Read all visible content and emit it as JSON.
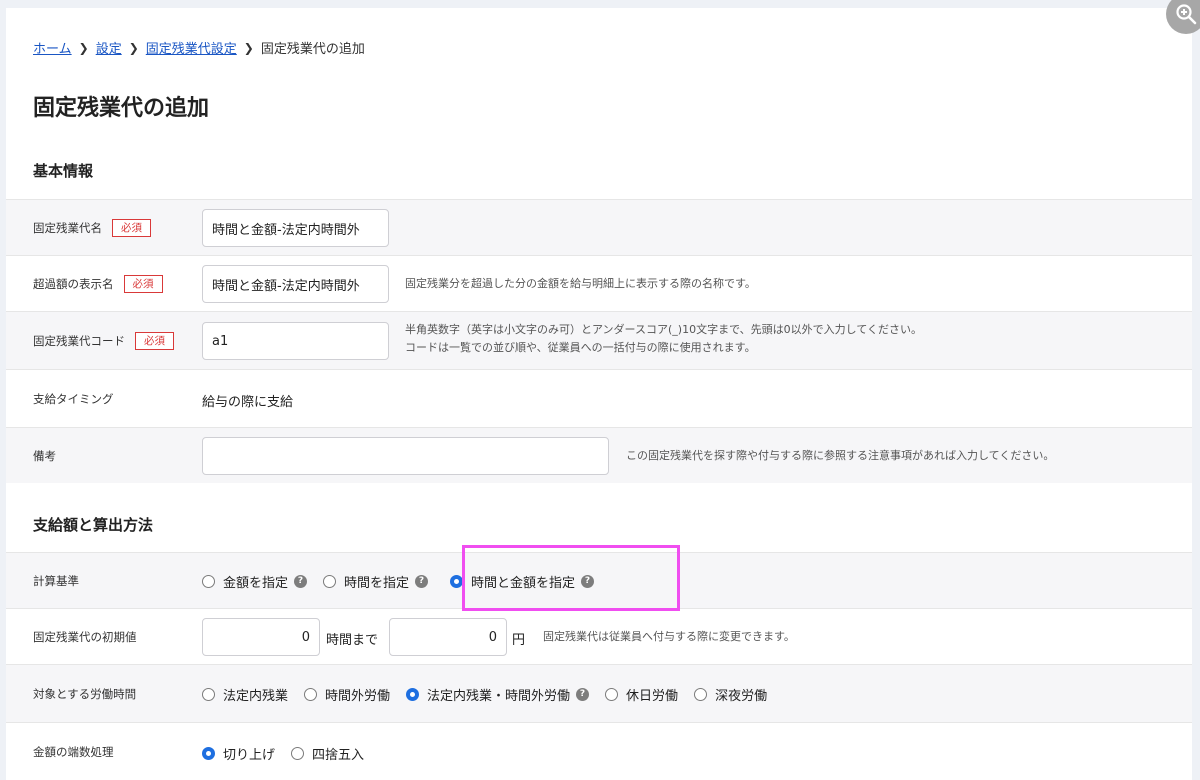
{
  "breadcrumb": {
    "home": "ホーム",
    "settings": "設定",
    "fixed_overtime_settings": "固定残業代設定",
    "current": "固定残業代の追加"
  },
  "page_title": "固定残業代の追加",
  "basic_info": {
    "heading": "基本情報",
    "required_badge": "必須",
    "name": {
      "label": "固定残業代名",
      "value": "時間と金額-法定内時間外"
    },
    "excess_display_name": {
      "label": "超過額の表示名",
      "value": "時間と金額-法定内時間外",
      "help": "固定残業分を超過した分の金額を給与明細上に表示する際の名称です。"
    },
    "code": {
      "label": "固定残業代コード",
      "value": "a1",
      "help_line1": "半角英数字（英字は小文字のみ可）とアンダースコア(_)10文字まで、先頭は0以外で入力してください。",
      "help_line2": "コードは一覧での並び順や、従業員への一括付与の際に使用されます。"
    },
    "payment_timing": {
      "label": "支給タイミング",
      "value": "給与の際に支給"
    },
    "notes": {
      "label": "備考",
      "value": "",
      "help": "この固定残業代を探す際や付与する際に参照する注意事項があれば入力してください。"
    }
  },
  "amount_section": {
    "heading": "支給額と算出方法",
    "calc_basis": {
      "label": "計算基準",
      "options": [
        "金額を指定",
        "時間を指定",
        "時間と金額を指定"
      ],
      "selected": "時間と金額を指定"
    },
    "initial_value": {
      "label": "固定残業代の初期値",
      "hours_value": "0",
      "hours_unit": "時間まで",
      "amount_value": "0",
      "amount_unit": "円",
      "help": "固定残業代は従業員へ付与する際に変更できます。"
    },
    "target_hours": {
      "label": "対象とする労働時間",
      "options": [
        "法定内残業",
        "時間外労働",
        "法定内残業・時間外労働",
        "休日労働",
        "深夜労働"
      ],
      "selected": "法定内残業・時間外労働"
    },
    "rounding": {
      "label": "金額の端数処理",
      "options": [
        "切り上げ",
        "四捨五入"
      ],
      "selected": "切り上げ"
    }
  },
  "icons": {
    "zoom": "zoom-in-icon",
    "help": "question-circle-icon",
    "breadcrumb_separator": "chevron-right-icon"
  },
  "colors": {
    "link": "#1a56c4",
    "required": "#d93939",
    "radio_selected": "#1e6fe0",
    "highlight": "#f04ef0"
  }
}
